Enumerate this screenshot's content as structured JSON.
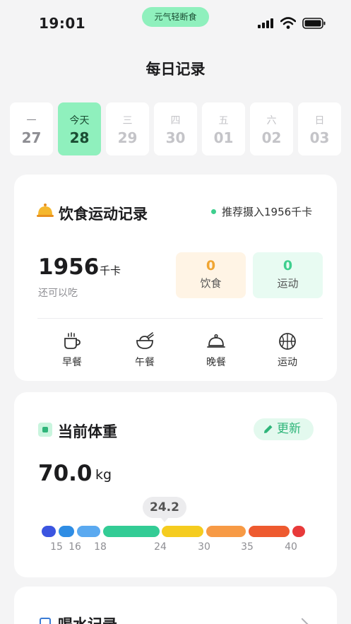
{
  "status": {
    "time": "19:01",
    "app_name": "元气轻断食"
  },
  "page": {
    "title": "每日记录"
  },
  "week": [
    {
      "name": "一",
      "date": "27",
      "active": false
    },
    {
      "name": "今天",
      "date": "28",
      "active": true
    },
    {
      "name": "三",
      "date": "29",
      "active": false
    },
    {
      "name": "四",
      "date": "30",
      "active": false
    },
    {
      "name": "五",
      "date": "01",
      "active": false
    },
    {
      "name": "六",
      "date": "02",
      "active": false
    },
    {
      "name": "日",
      "date": "03",
      "active": false
    }
  ],
  "diet": {
    "title": "饮食运动记录",
    "recommend": "推荐摄入1956千卡",
    "remaining_value": "1956",
    "remaining_unit": "千卡",
    "remaining_label": "还可以吃",
    "food": {
      "value": "0",
      "label": "饮食"
    },
    "sport": {
      "value": "0",
      "label": "运动"
    },
    "meals": [
      {
        "label": "早餐",
        "icon": "coffee-cup-icon"
      },
      {
        "label": "午餐",
        "icon": "rice-bowl-icon"
      },
      {
        "label": "晚餐",
        "icon": "food-cloche-icon"
      },
      {
        "label": "运动",
        "icon": "basketball-icon"
      }
    ]
  },
  "weight": {
    "title": "当前体重",
    "update_label": "更新",
    "value": "70.0",
    "unit": "kg",
    "bmi": "24.2",
    "scale_ticks": [
      "15",
      "16",
      "18",
      "24",
      "30",
      "35",
      "40"
    ],
    "segment_colors": [
      "#3b55e0",
      "#2f8de4",
      "#5aa9f0",
      "#33cc95",
      "#f5cc1f",
      "#f79a45",
      "#ee5a2f",
      "#e83a3a"
    ]
  },
  "water": {
    "title": "喝水记录"
  },
  "colors": {
    "accent": "#8ff0bd",
    "green": "#3ecf8e",
    "orange": "#f0a532"
  }
}
